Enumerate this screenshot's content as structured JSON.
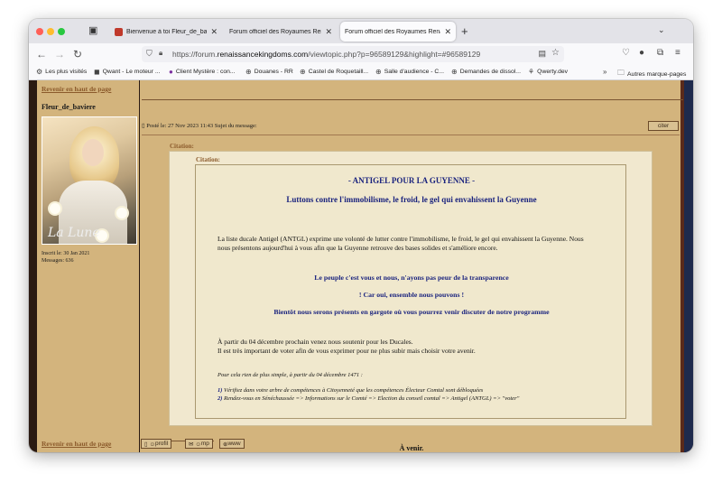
{
  "tabs": [
    {
      "label": "Bienvenue à toi Fleur_de_baviere",
      "favicon_color": "#c0392b"
    },
    {
      "label": "Forum officiel des Royaumes Renaissants",
      "favicon_color": "#cccccc"
    },
    {
      "label": "Forum officiel des Royaumes Renaissants",
      "favicon_color": "#cccccc"
    }
  ],
  "address": {
    "prefix": "https://forum.",
    "domain": "renaissancekingdoms.com",
    "path": "/viewtopic.php?p=96589129&highlight=#96589129"
  },
  "bookmarks": [
    {
      "label": "Les plus visités",
      "icon": "gear-icon"
    },
    {
      "label": "Qwant - Le moteur ...",
      "icon": "qwant-icon"
    },
    {
      "label": "Client Mystère : con...",
      "icon": "client-icon"
    },
    {
      "label": "Douanes - RR",
      "icon": "globe-icon"
    },
    {
      "label": "Castel de Roquetaill...",
      "icon": "globe-icon"
    },
    {
      "label": "Salle d'audience - C...",
      "icon": "globe-icon"
    },
    {
      "label": "Demandes de dissol...",
      "icon": "globe-icon"
    },
    {
      "label": "Qwerty.dev",
      "icon": "leaf-icon"
    },
    {
      "label": "Autres marque-pages",
      "icon": "folder-icon"
    }
  ],
  "forum": {
    "top_link": "Revenir en haut de page",
    "author": "Fleur_de_baviere",
    "avatar_signature": "La Lune",
    "joined": "Inscrit le: 30 Jan 2021",
    "messages": "Messages: 636",
    "post_header": "Posté le: 27 Nov 2023 11:43   Sujet du message:",
    "quote_button": "citer",
    "citation_label": "Citation:",
    "quote": {
      "title": "- ANTIGEL POUR LA GUYENNE -",
      "subtitle": "Luttons contre l'immobilisme, le froid, le gel qui envahissent la Guyenne",
      "para1": "La liste ducale Antigel (ANTGL) exprime une volonté de lutter contre l'immobilisme, le froid, le gel qui envahissent la Guyenne. Nous nous présentons aujourd'hui à vous afin que la Guyenne retrouve des bases solides et s'améliore encore.",
      "slogan1": "Le peuple c'est vous et nous, n'ayons pas peur de la transparence",
      "slogan2": "! Car oui, ensemble nous pouvons !",
      "slogan3": "Bientôt nous serons présents en gargote où vous pourrez venir discuter de notre programme",
      "para2a": "À partir du 04 décembre prochain venez nous soutenir pour les Ducales.",
      "para2b": "Il est très important de voter afin de vous exprimer pour ne plus subir mais choisir votre avenir.",
      "howto": "Pour cela rien de plus simple, à partir du 04 décembre 1471 :",
      "step1_num": "1)",
      "step1": "Vérifiez dans votre arbre de compétences à Citoyenneté que les compétences Électeur Comtal sont débloquées",
      "step2_num": "2)",
      "step2": "Rendez-vous en Sénéchaussée => Informations sur le Comté => Election du conseil comtal => Antigel (ANTGL) => \"voter\""
    },
    "signature": "À venir.",
    "bottom_link": "Revenir en haut de page",
    "buttons": {
      "profil": "profil",
      "mp": "mp",
      "www": "www"
    }
  }
}
